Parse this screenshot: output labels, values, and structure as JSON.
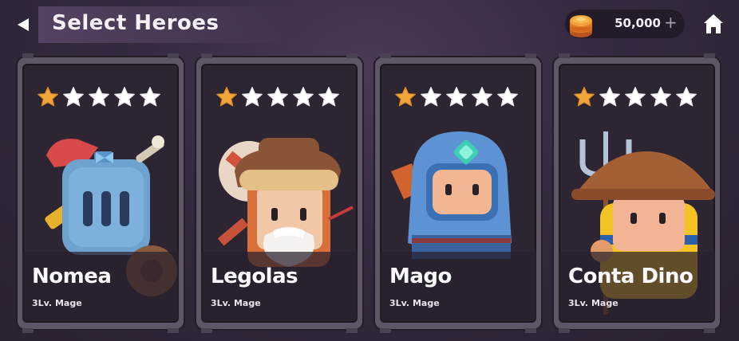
{
  "header": {
    "title": "Select Heroes",
    "back_icon": "back-arrow-icon",
    "coins": "50,000",
    "coin_plus": "+",
    "home_icon": "home-icon"
  },
  "colors": {
    "star_filled": "#f4a53a",
    "star_empty": "#ffffff"
  },
  "heroes": [
    {
      "name": "Nomea",
      "level": "3Lv. Mage",
      "stars": 1
    },
    {
      "name": "Legolas",
      "level": "3Lv. Mage",
      "stars": 1
    },
    {
      "name": "Mago",
      "level": "3Lv. Mage",
      "stars": 1
    },
    {
      "name": "Conta Dino",
      "level": "3Lv. Mage",
      "stars": 1
    }
  ]
}
